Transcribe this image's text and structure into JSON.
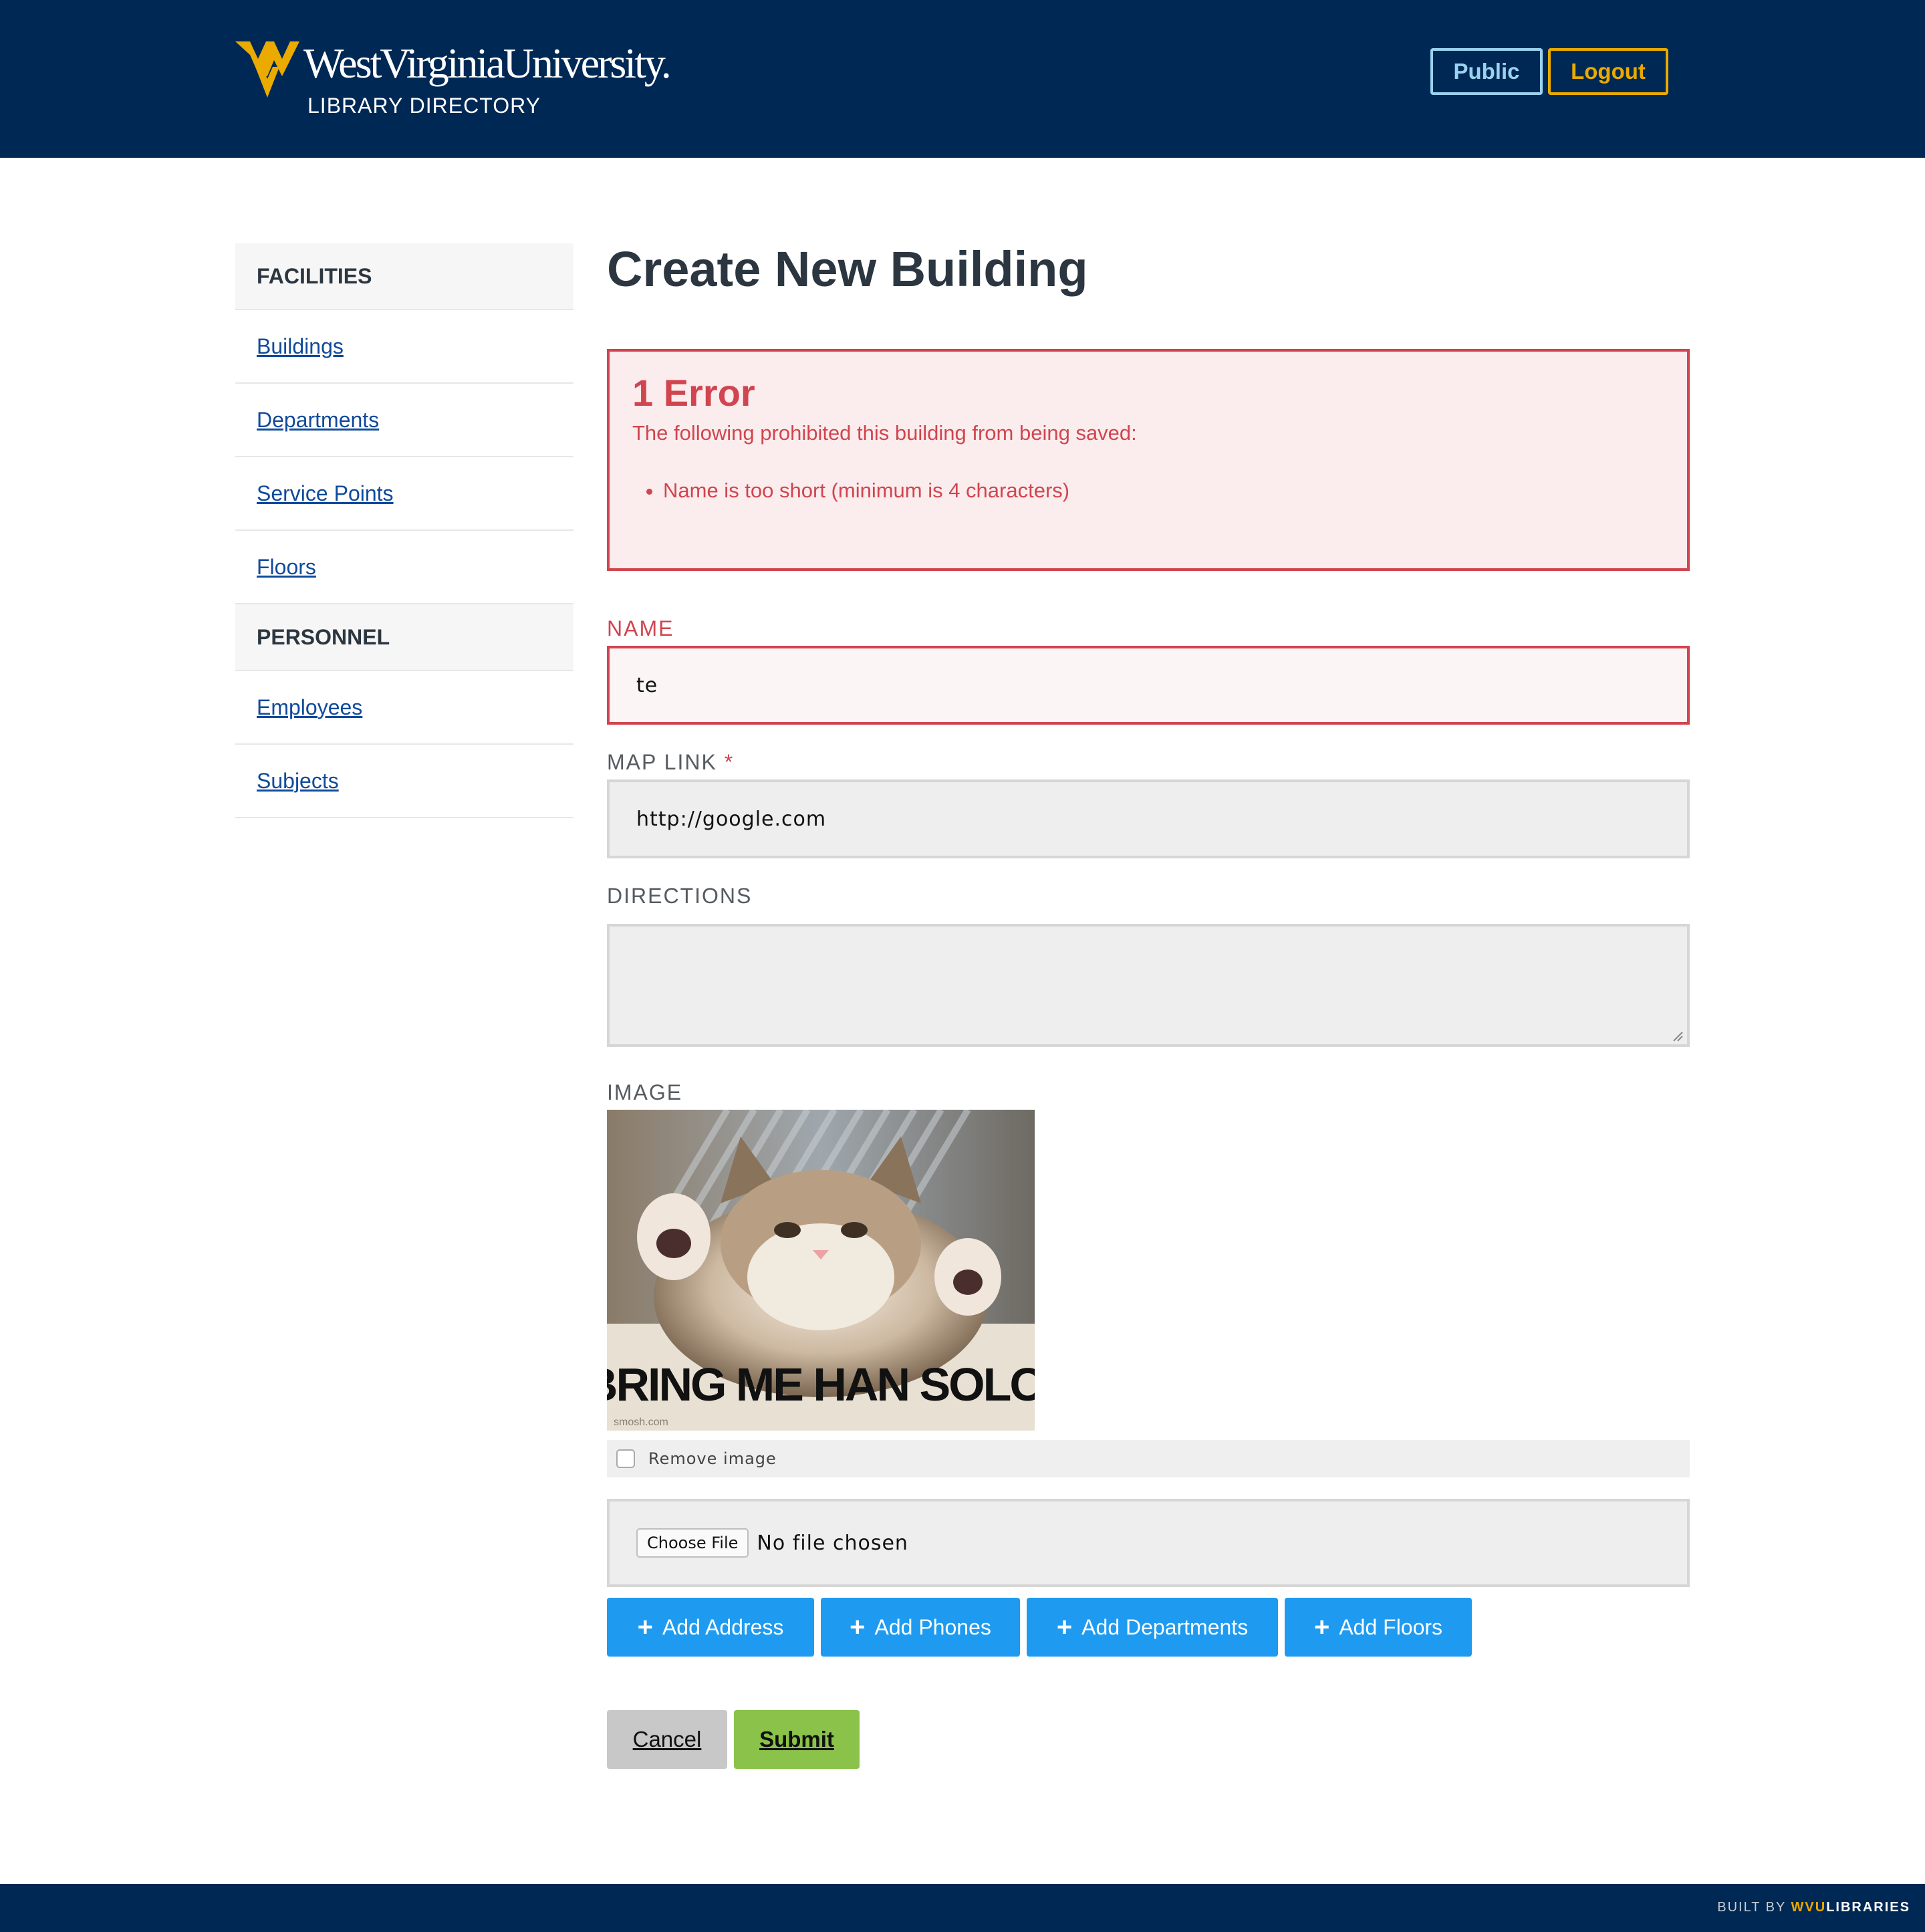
{
  "header": {
    "university": "WestVirginiaUniversity.",
    "subtitle": "LIBRARY DIRECTORY",
    "public_label": "Public",
    "logout_label": "Logout",
    "brand_blue": "#002855",
    "brand_gold": "#eaaa00"
  },
  "sidebar": {
    "facilities_heading": "FACILITIES",
    "facilities": [
      "Buildings",
      "Departments",
      "Service Points",
      "Floors"
    ],
    "personnel_heading": "PERSONNEL",
    "personnel": [
      "Employees",
      "Subjects"
    ]
  },
  "page": {
    "title": "Create New Building"
  },
  "errors": {
    "title": "1 Error",
    "summary": "The following prohibited this building from being saved:",
    "items": [
      "Name is too short (minimum is 4 characters)"
    ],
    "color": "#d0454f"
  },
  "form": {
    "name_label": "NAME",
    "name_value": "te",
    "map_label": "MAP LINK",
    "map_required": "*",
    "map_value": "http://google.com",
    "directions_label": "DIRECTIONS",
    "directions_value": "",
    "image_label": "IMAGE",
    "image_caption": "BRING ME HAN SOLO!",
    "image_watermark": "smosh.com",
    "remove_image_label": "Remove image",
    "remove_image_checked": false,
    "file_button": "Choose File",
    "file_status": "No file chosen"
  },
  "add_buttons": {
    "address": "Add Address",
    "phones": "Add Phones",
    "departments": "Add Departments",
    "floors": "Add Floors",
    "color": "#1e9bf0"
  },
  "actions": {
    "cancel": "Cancel",
    "submit": "Submit"
  },
  "footer": {
    "built_by": "BUILT BY ",
    "wvu": "WVU",
    "libraries": "LIBRARIES"
  }
}
